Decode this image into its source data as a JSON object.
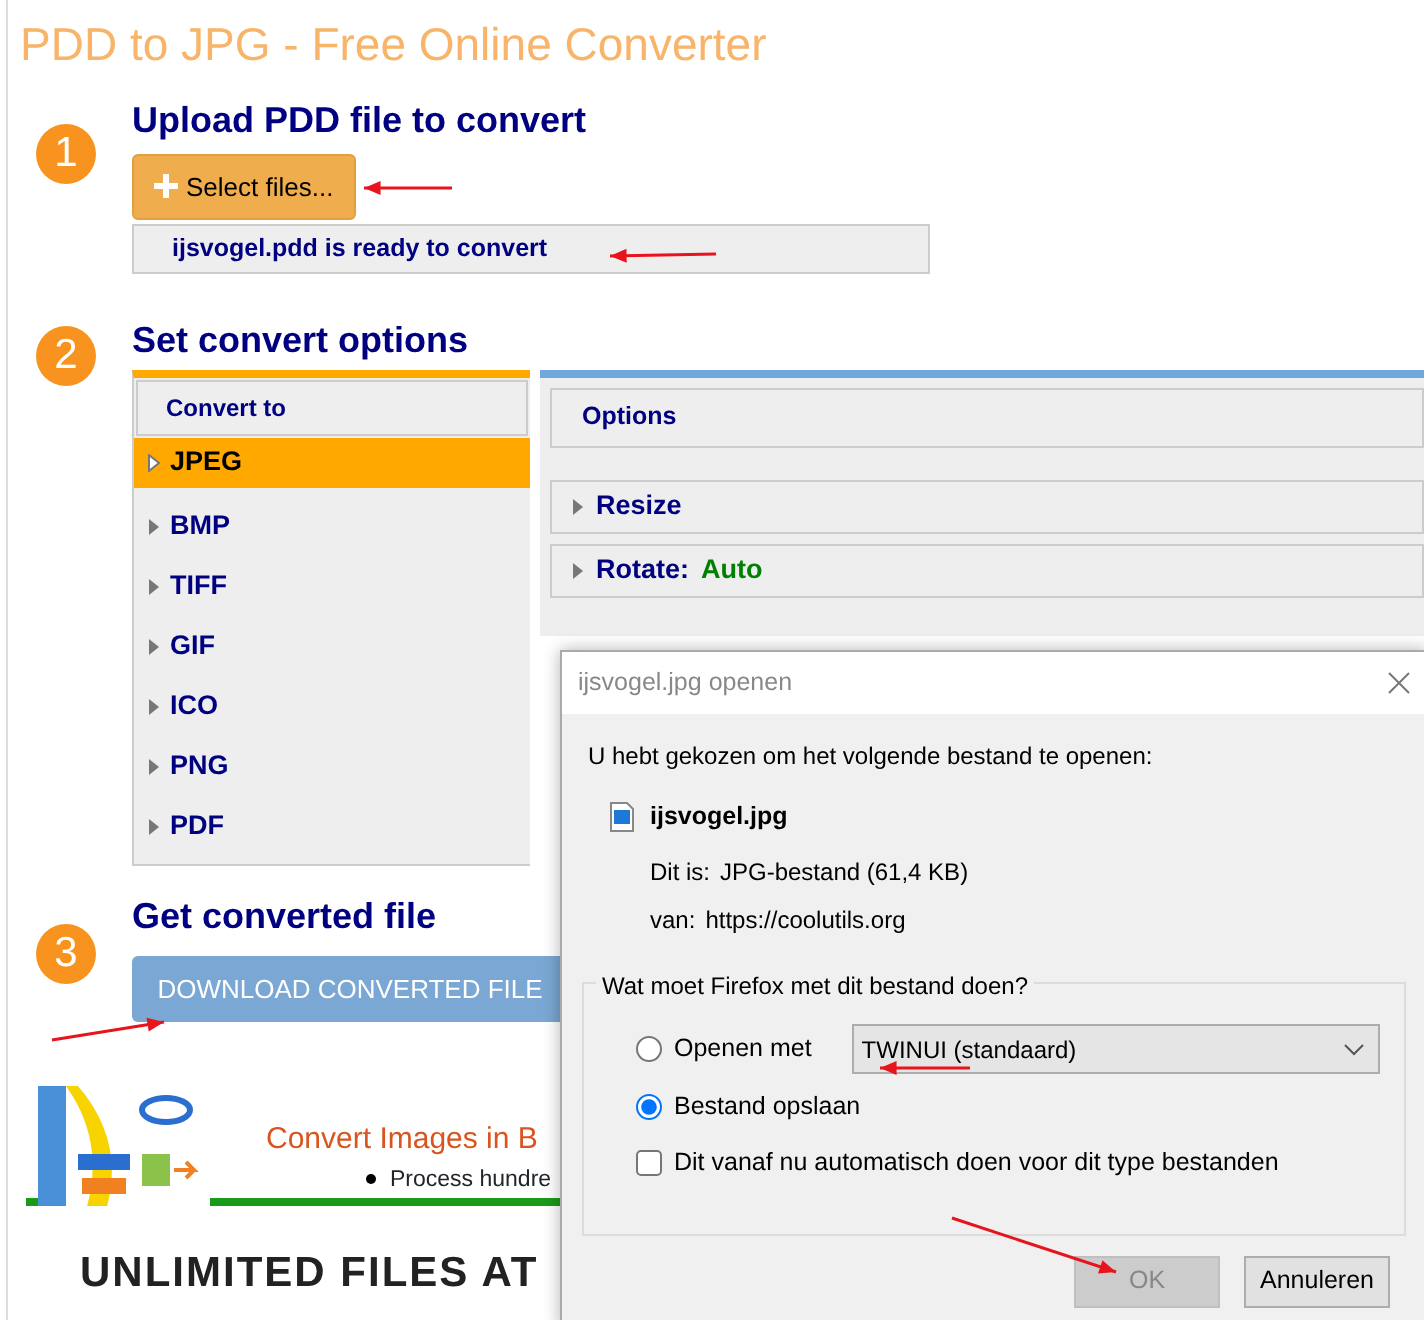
{
  "page": {
    "title": "PDD to JPG - Free Online Converter"
  },
  "steps": [
    {
      "number": "1",
      "heading": "Upload PDD file to convert"
    },
    {
      "number": "2",
      "heading": "Set convert options"
    },
    {
      "number": "3",
      "heading": "Get converted file"
    }
  ],
  "upload": {
    "button": "Select files...",
    "status": "ijsvogel.pdd is ready to convert"
  },
  "convert_to": {
    "header": "Convert to",
    "formats": [
      {
        "label": "JPEG",
        "selected": true
      },
      {
        "label": "BMP",
        "selected": false
      },
      {
        "label": "TIFF",
        "selected": false
      },
      {
        "label": "GIF",
        "selected": false
      },
      {
        "label": "ICO",
        "selected": false
      },
      {
        "label": "PNG",
        "selected": false
      },
      {
        "label": "PDF",
        "selected": false
      }
    ]
  },
  "options": {
    "header": "Options",
    "sections": [
      {
        "label": "Resize"
      },
      {
        "label": "Rotate:",
        "value": "Auto"
      }
    ]
  },
  "download": {
    "button": "DOWNLOAD CONVERTED FILE"
  },
  "promo": {
    "heading": "Convert Images in B",
    "bullets": [
      "Process hundre"
    ],
    "banner": "UNLIMITED FILES AT"
  },
  "dialog": {
    "title": "ijsvogel.jpg openen",
    "intro": "U hebt gekozen om het volgende bestand te openen:",
    "file": "ijsvogel.jpg",
    "details": [
      {
        "label": "Dit is:",
        "value": "JPG-bestand (61,4 KB)"
      },
      {
        "label": "van:",
        "value": "https://coolutils.org"
      }
    ],
    "question": "Wat moet Firefox met dit bestand doen?",
    "choices": [
      {
        "label": "Openen met",
        "selected": false,
        "app": "TWINUI (standaard)"
      },
      {
        "label": "Bestand opslaan",
        "selected": true
      }
    ],
    "remember": {
      "label": "Dit vanaf nu automatisch doen voor dit type bestanden",
      "checked": false
    },
    "buttons": [
      {
        "label": "OK",
        "disabled": true
      },
      {
        "label": "Annuleren",
        "disabled": false
      }
    ]
  }
}
